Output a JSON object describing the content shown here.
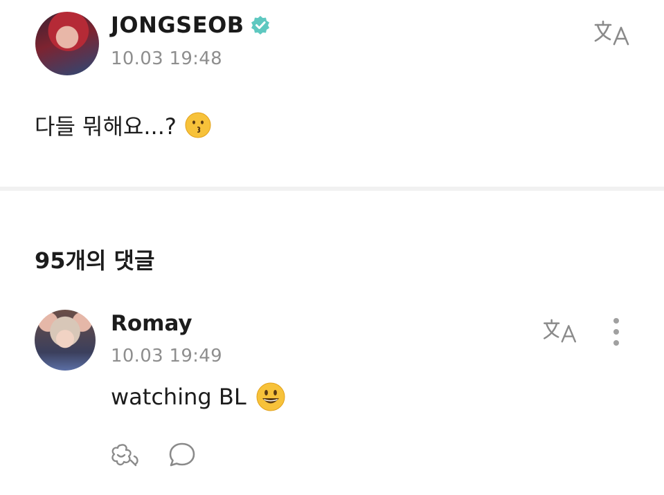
{
  "post": {
    "author": "JONGSEOB",
    "timestamp": "10.03 19:48",
    "text": "다들 뭐해요...?",
    "emoji": "kissing-face-emoji",
    "verified_color": "#5ec8c0"
  },
  "comments_header": {
    "label": "95개의 댓글"
  },
  "comment": {
    "author": "Romay",
    "timestamp": "10.03 19:49",
    "text": "watching BL",
    "emoji": "grinning-face-emoji"
  },
  "icons": {
    "translate": "translate-icon",
    "more": "more-vertical-icon",
    "reaction": "add-reaction-icon",
    "reply": "reply-bubble-icon"
  },
  "colors": {
    "text": "#1c1c1c",
    "muted": "#8e8e8e",
    "divider": "#f1f1f1",
    "emoji_yellow": "#f7c23a"
  }
}
